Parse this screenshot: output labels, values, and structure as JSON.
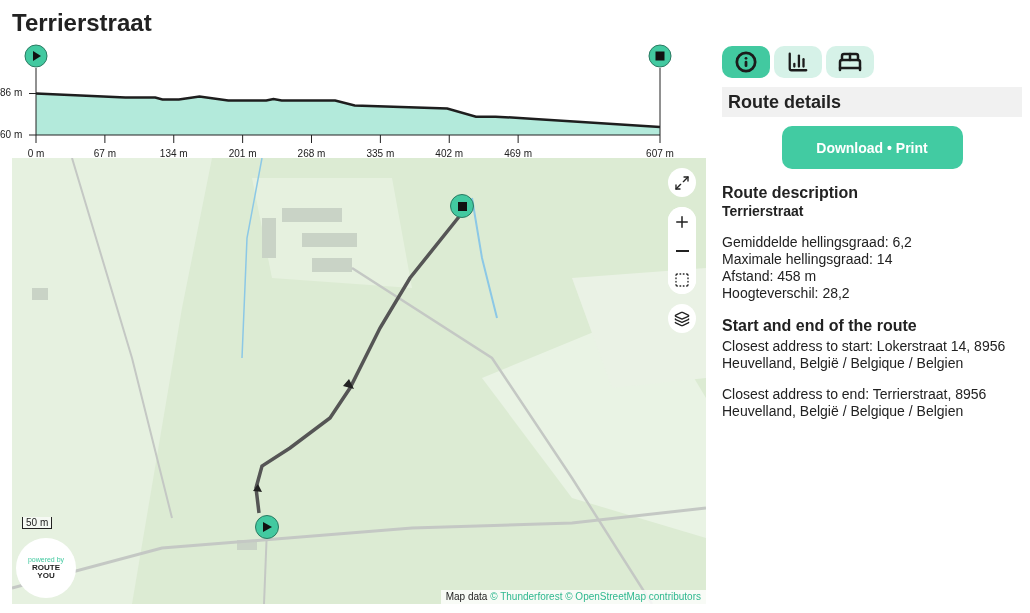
{
  "title": "Terrierstraat",
  "elevation": {
    "chart_data": {
      "type": "area",
      "x": [
        0,
        87,
        116,
        123,
        139,
        159,
        187,
        224,
        231,
        239,
        291,
        310,
        400,
        428,
        447,
        485,
        607
      ],
      "series": [
        {
          "color": "#1e1e1e",
          "values": [
            86,
            83.5,
            83.5,
            82.3,
            82.3,
            84.2,
            81.6,
            81.6,
            82.6,
            81.6,
            81.6,
            78.5,
            76.6,
            71.5,
            71.5,
            70.1,
            65
          ]
        }
      ],
      "xlim": [
        0,
        607
      ],
      "ylim": [
        60,
        102
      ],
      "xticks": [
        {
          "value": 0,
          "label": "0 m"
        },
        {
          "value": 67,
          "label": "67 m"
        },
        {
          "value": 134,
          "label": "134 m"
        },
        {
          "value": 201,
          "label": "201 m"
        },
        {
          "value": 268,
          "label": "268 m"
        },
        {
          "value": 335,
          "label": "335 m"
        },
        {
          "value": 402,
          "label": "402 m"
        },
        {
          "value": 469,
          "label": "469 m"
        },
        {
          "value": 607,
          "label": "607 m"
        }
      ],
      "yticks": [
        {
          "value": 60,
          "label": "60 m"
        },
        {
          "value": 86,
          "label": "86 m"
        }
      ]
    }
  },
  "map": {
    "scale": "50 m",
    "logo": {
      "tagline": "powered by",
      "name_line_1": "ROUTE",
      "name_line_2": "YOU"
    },
    "attribution": {
      "prefix": "Map data",
      "links": [
        "© Thunderforest",
        "© OpenStreetMap contributors"
      ]
    }
  },
  "tabs": [
    {
      "kind": "info",
      "selected": true
    },
    {
      "kind": "chart",
      "selected": false
    },
    {
      "kind": "bed",
      "selected": false
    }
  ],
  "details": {
    "header": "Route details",
    "button": "Download • Print",
    "description_heading": "Route description",
    "route_name": "Terrierstraat",
    "stats": [
      "Gemiddelde hellingsgraad: 6,2",
      "Maximale hellingsgraad: 14",
      "Afstand: 458 m",
      "Hoogteverschil: 28,2"
    ],
    "start_end_heading": "Start and end of the route",
    "addresses": [
      "Closest address to start: Lokerstraat 14, 8956 Heuvelland, België / Belgique / Belgien",
      "Closest address to end: Terrierstraat, 8956 Heuvelland, België / Belgique / Belgien"
    ]
  }
}
